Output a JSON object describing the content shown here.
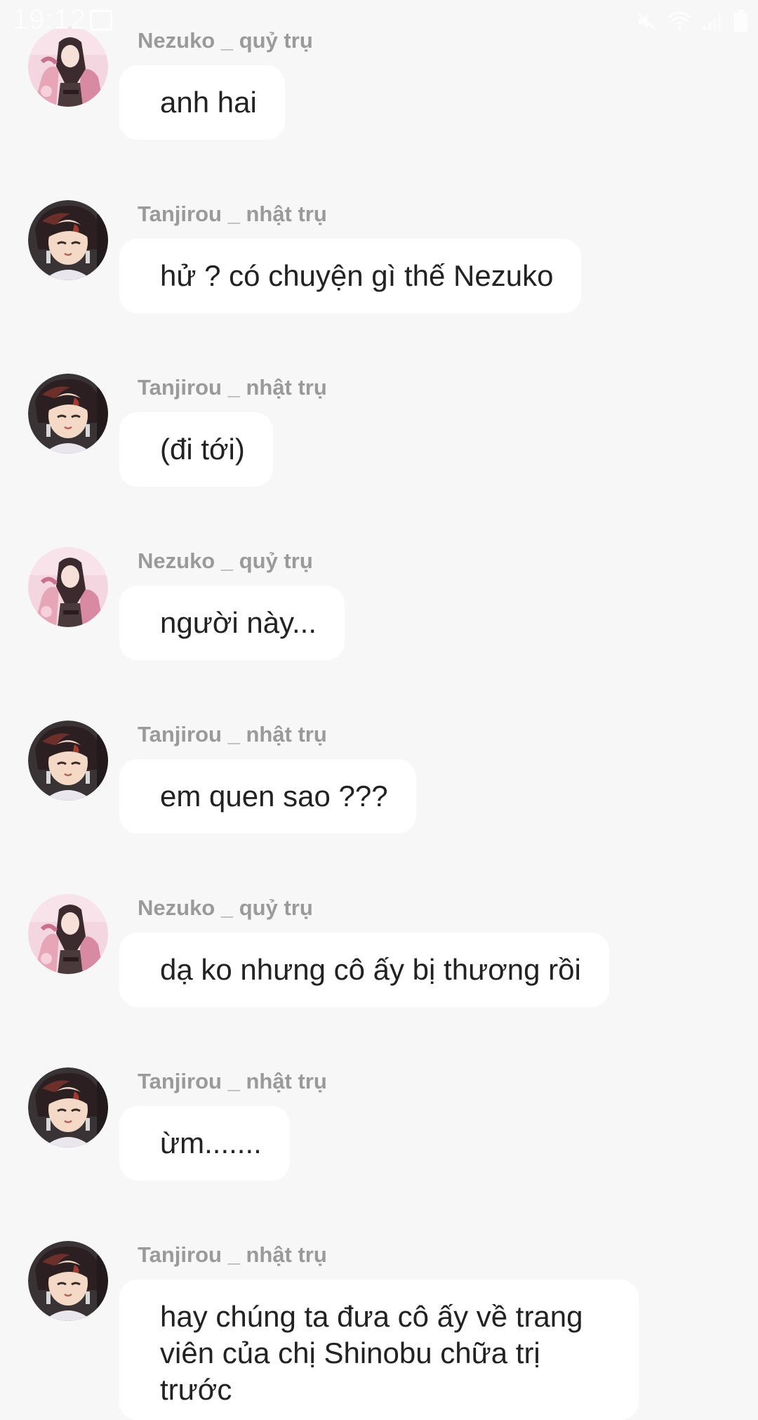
{
  "status_bar": {
    "time": "19:12",
    "icons": [
      "image-icon",
      "mute-icon",
      "wifi-icon",
      "signal-icon",
      "battery-icon"
    ]
  },
  "colors": {
    "background": "#f7f7f7",
    "bubble": "#ffffff",
    "sender_name": "#9a9a9a",
    "message_text": "#222222"
  },
  "messages": [
    {
      "sender": "Nezuko _ quỷ trụ",
      "avatar": "nezuko-avatar",
      "text": "anh hai"
    },
    {
      "sender": "Tanjirou _ nhật trụ",
      "avatar": "tanjirou-avatar",
      "text": "hử ? có chuyện gì thế Nezuko"
    },
    {
      "sender": "Tanjirou _ nhật trụ",
      "avatar": "tanjirou-avatar",
      "text": "(đi tới)"
    },
    {
      "sender": "Nezuko _ quỷ trụ",
      "avatar": "nezuko-avatar",
      "text": "người này..."
    },
    {
      "sender": "Tanjirou _ nhật trụ",
      "avatar": "tanjirou-avatar",
      "text": "em quen sao ???"
    },
    {
      "sender": "Nezuko _ quỷ trụ",
      "avatar": "nezuko-avatar",
      "text": "dạ ko nhưng cô ấy bị thương rồi"
    },
    {
      "sender": "Tanjirou _ nhật trụ",
      "avatar": "tanjirou-avatar",
      "text": "ừm......."
    },
    {
      "sender": "Tanjirou _ nhật trụ",
      "avatar": "tanjirou-avatar",
      "text": "hay chúng ta đưa cô ấy về trang viên của chị Shinobu chữa trị trước"
    }
  ]
}
